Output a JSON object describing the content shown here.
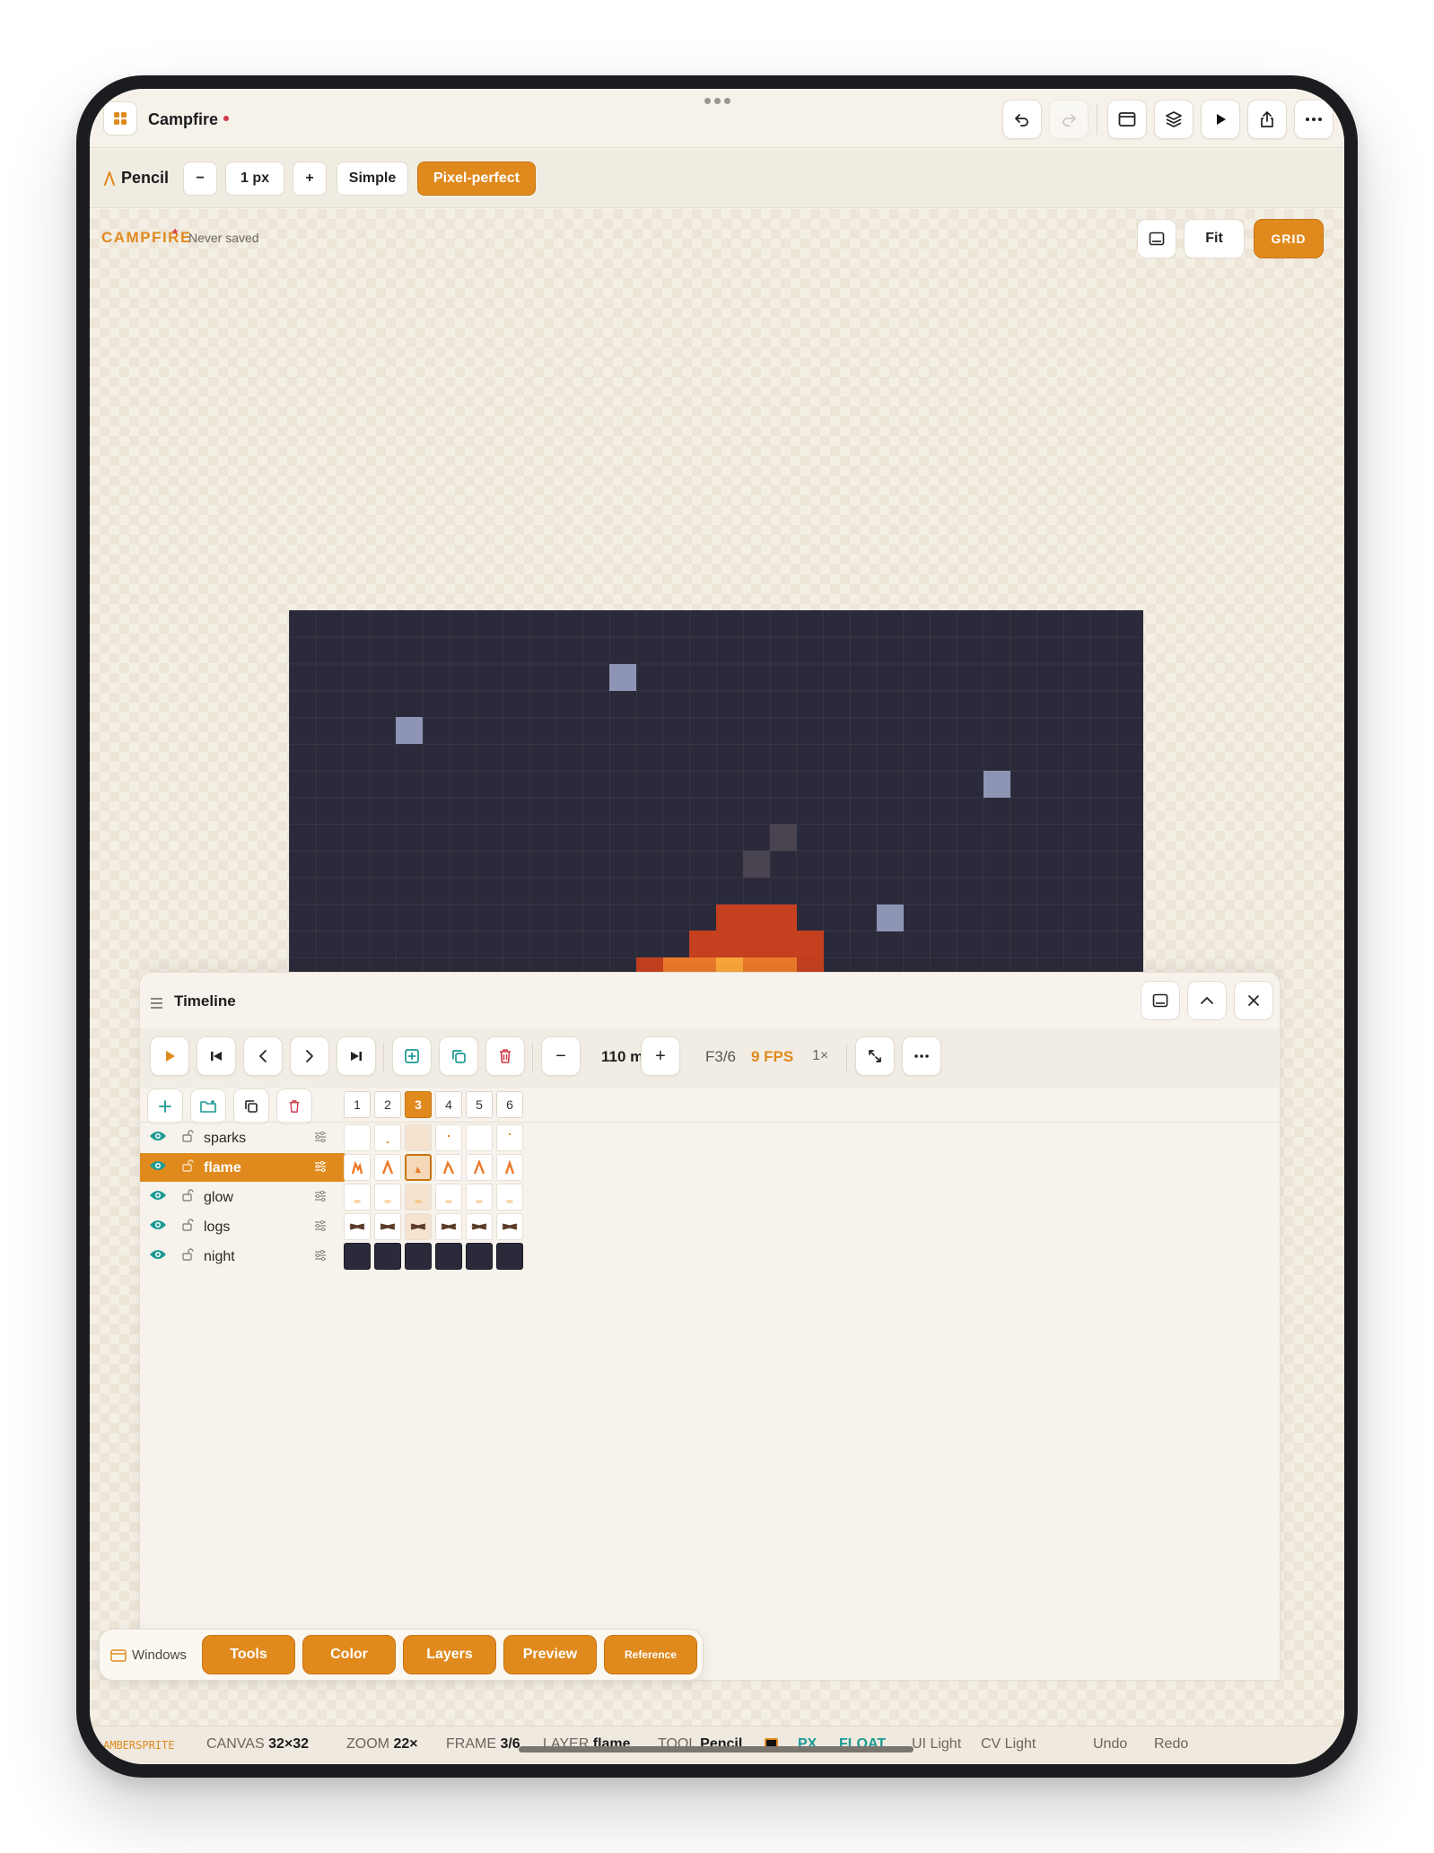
{
  "app": {
    "document_title": "Campfire"
  },
  "tool_options": {
    "tool_name": "Pencil",
    "size_value": "1 px",
    "mode_simple": "Simple",
    "mode_pixel_perfect": "Pixel-perfect",
    "minus": "−",
    "plus": "+"
  },
  "canvas": {
    "title": "CAMPFIRE",
    "star": "*",
    "save_status": "Never saved",
    "fit_label": "Fit",
    "grid_label": "GRID"
  },
  "timeline": {
    "title": "Timeline",
    "duration": "110 ms",
    "frame_indicator": "F3/6",
    "fps": "9 FPS",
    "speed": "1×",
    "minus": "−",
    "plus": "+",
    "frames": [
      "1",
      "2",
      "3",
      "4",
      "5",
      "6"
    ],
    "current_frame": 3,
    "layers": [
      {
        "name": "sparks",
        "selected": false
      },
      {
        "name": "flame",
        "selected": true
      },
      {
        "name": "glow",
        "selected": false
      },
      {
        "name": "logs",
        "selected": false
      },
      {
        "name": "night",
        "selected": false
      }
    ]
  },
  "dock": {
    "label": "Windows",
    "buttons": [
      "Tools",
      "Color",
      "Layers",
      "Preview",
      "Reference"
    ]
  },
  "status_bar": {
    "brand": "AMBERSPRITE",
    "canvas_label": "CANVAS",
    "canvas_value": "32×32",
    "zoom_label": "ZOOM",
    "zoom_value": "22×",
    "frame_label": "FRAME",
    "frame_value": "3/6",
    "layer_label": "LAYER",
    "layer_value": "flame",
    "tool_label": "TOOL",
    "tool_value": "Pencil",
    "px": "PX",
    "float": "FLOAT",
    "ui_theme": "UI Light",
    "cv_theme": "CV Light",
    "undo": "Undo",
    "redo": "Redo"
  },
  "colors": {
    "accent": "#e08a1e",
    "night": "#2b2a3a",
    "teal": "#1c9a94",
    "alert": "#d0394a"
  }
}
